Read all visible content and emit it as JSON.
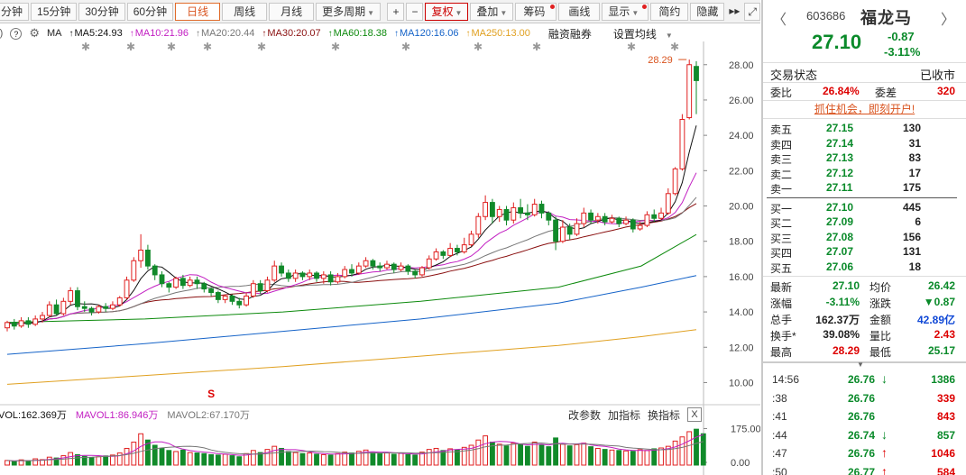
{
  "toolbar": {
    "periods": [
      "分钟",
      "15分钟",
      "30分钟",
      "60分钟",
      "日线",
      "周线",
      "月线",
      "更多周期"
    ],
    "active_period": "日线",
    "plus": "+",
    "minus": "−",
    "fuquan": "复权",
    "diejia": "叠加",
    "chouma": "筹码",
    "huaxian": "画线",
    "xianshi": "显示",
    "jianyue": "简约",
    "yincang": "隐藏",
    "more": "▸▸",
    "maximize": "⤢"
  },
  "ma_bar": {
    "lead": "()",
    "help": "?",
    "settings": "⚙",
    "items": [
      {
        "label": "MA",
        "color": "#222222",
        "arrow": ""
      },
      {
        "label": "MA5:24.93",
        "color": "#111111",
        "arrow": "↑"
      },
      {
        "label": "MA10:21.96",
        "color": "#c21fc2",
        "arrow": "↑"
      },
      {
        "label": "MA20:20.44",
        "color": "#777777",
        "arrow": "↑"
      },
      {
        "label": "MA30:20.07",
        "color": "#8a1010",
        "arrow": "↑"
      },
      {
        "label": "MA60:18.38",
        "color": "#0d8a0d",
        "arrow": "↑"
      },
      {
        "label": "MA120:16.06",
        "color": "#1563c8",
        "arrow": "↑"
      },
      {
        "label": "MA250:13.00",
        "color": "#e0a020",
        "arrow": "↑"
      }
    ],
    "rongzi": "融资融券",
    "settings_ma": "设置均线"
  },
  "chart_data": {
    "type": "candlestick",
    "y_ticks": [
      "28.00",
      "26.00",
      "24.00",
      "22.00",
      "20.00",
      "18.00",
      "16.00",
      "14.00",
      "12.00",
      "10.00"
    ],
    "ylim": [
      8.9,
      28.6
    ],
    "high_label": "28.29",
    "signal_label": "S",
    "candles": [
      {
        "o": 13.1,
        "c": 13.4,
        "h": 13.5,
        "l": 12.9
      },
      {
        "o": 13.4,
        "c": 13.2,
        "h": 13.6,
        "l": 13.0
      },
      {
        "o": 13.2,
        "c": 13.5,
        "h": 13.7,
        "l": 13.1
      },
      {
        "o": 13.5,
        "c": 13.3,
        "h": 13.7,
        "l": 13.1
      },
      {
        "o": 13.3,
        "c": 13.6,
        "h": 13.8,
        "l": 13.2
      },
      {
        "o": 13.6,
        "c": 13.8,
        "h": 14.0,
        "l": 13.4
      },
      {
        "o": 13.8,
        "c": 14.4,
        "h": 14.6,
        "l": 13.7
      },
      {
        "o": 14.4,
        "c": 13.9,
        "h": 14.7,
        "l": 13.8
      },
      {
        "o": 13.9,
        "c": 14.6,
        "h": 14.8,
        "l": 13.8
      },
      {
        "o": 14.6,
        "c": 15.2,
        "h": 15.4,
        "l": 14.4
      },
      {
        "o": 15.2,
        "c": 14.3,
        "h": 15.4,
        "l": 14.1
      },
      {
        "o": 14.3,
        "c": 14.2,
        "h": 14.6,
        "l": 14.0
      },
      {
        "o": 14.2,
        "c": 14.0,
        "h": 14.3,
        "l": 13.8
      },
      {
        "o": 14.0,
        "c": 14.3,
        "h": 14.4,
        "l": 13.9
      },
      {
        "o": 14.3,
        "c": 14.2,
        "h": 14.5,
        "l": 14.0
      },
      {
        "o": 14.2,
        "c": 14.4,
        "h": 14.6,
        "l": 14.1
      },
      {
        "o": 14.4,
        "c": 14.8,
        "h": 14.9,
        "l": 14.3
      },
      {
        "o": 14.8,
        "c": 15.8,
        "h": 16.0,
        "l": 14.7
      },
      {
        "o": 15.8,
        "c": 16.9,
        "h": 17.1,
        "l": 15.7
      },
      {
        "o": 16.9,
        "c": 17.5,
        "h": 18.4,
        "l": 16.5
      },
      {
        "o": 17.5,
        "c": 16.6,
        "h": 17.8,
        "l": 16.4
      },
      {
        "o": 16.6,
        "c": 16.1,
        "h": 16.7,
        "l": 15.8
      },
      {
        "o": 16.1,
        "c": 15.6,
        "h": 16.3,
        "l": 15.4
      },
      {
        "o": 15.6,
        "c": 15.4,
        "h": 15.7,
        "l": 15.1
      },
      {
        "o": 15.4,
        "c": 15.9,
        "h": 16.0,
        "l": 15.3
      },
      {
        "o": 15.9,
        "c": 15.5,
        "h": 16.1,
        "l": 15.3
      },
      {
        "o": 15.5,
        "c": 15.8,
        "h": 16.0,
        "l": 15.4
      },
      {
        "o": 15.8,
        "c": 15.6,
        "h": 16.0,
        "l": 15.3
      },
      {
        "o": 15.6,
        "c": 15.3,
        "h": 15.7,
        "l": 15.1
      },
      {
        "o": 15.3,
        "c": 15.1,
        "h": 15.4,
        "l": 14.9
      },
      {
        "o": 15.1,
        "c": 14.7,
        "h": 15.2,
        "l": 14.5
      },
      {
        "o": 14.7,
        "c": 14.9,
        "h": 15.0,
        "l": 14.5
      },
      {
        "o": 14.9,
        "c": 14.6,
        "h": 15.0,
        "l": 14.4
      },
      {
        "o": 14.6,
        "c": 14.4,
        "h": 14.8,
        "l": 14.2
      },
      {
        "o": 14.4,
        "c": 14.9,
        "h": 15.1,
        "l": 14.3
      },
      {
        "o": 14.9,
        "c": 15.6,
        "h": 15.8,
        "l": 14.8
      },
      {
        "o": 15.6,
        "c": 15.2,
        "h": 15.8,
        "l": 15.0
      },
      {
        "o": 15.2,
        "c": 15.8,
        "h": 16.0,
        "l": 15.1
      },
      {
        "o": 15.8,
        "c": 16.6,
        "h": 16.9,
        "l": 15.7
      },
      {
        "o": 16.6,
        "c": 16.2,
        "h": 16.8,
        "l": 16.0
      },
      {
        "o": 16.2,
        "c": 15.9,
        "h": 16.4,
        "l": 15.7
      },
      {
        "o": 15.9,
        "c": 16.2,
        "h": 16.4,
        "l": 15.7
      },
      {
        "o": 16.2,
        "c": 16.0,
        "h": 16.3,
        "l": 15.8
      },
      {
        "o": 16.0,
        "c": 16.2,
        "h": 16.4,
        "l": 15.8
      },
      {
        "o": 16.2,
        "c": 15.9,
        "h": 16.3,
        "l": 15.7
      },
      {
        "o": 15.9,
        "c": 16.1,
        "h": 16.3,
        "l": 15.6
      },
      {
        "o": 16.1,
        "c": 15.7,
        "h": 16.3,
        "l": 15.5
      },
      {
        "o": 15.7,
        "c": 16.0,
        "h": 16.2,
        "l": 15.6
      },
      {
        "o": 16.0,
        "c": 16.4,
        "h": 16.6,
        "l": 15.9
      },
      {
        "o": 16.4,
        "c": 16.2,
        "h": 16.7,
        "l": 16.0
      },
      {
        "o": 16.2,
        "c": 16.6,
        "h": 16.8,
        "l": 16.1
      },
      {
        "o": 16.6,
        "c": 16.9,
        "h": 17.1,
        "l": 16.5
      },
      {
        "o": 16.9,
        "c": 16.6,
        "h": 17.0,
        "l": 16.4
      },
      {
        "o": 16.6,
        "c": 16.5,
        "h": 16.8,
        "l": 16.3
      },
      {
        "o": 16.5,
        "c": 16.7,
        "h": 16.9,
        "l": 16.4
      },
      {
        "o": 16.7,
        "c": 16.4,
        "h": 16.8,
        "l": 16.2
      },
      {
        "o": 16.4,
        "c": 16.6,
        "h": 16.8,
        "l": 16.3
      },
      {
        "o": 16.6,
        "c": 16.3,
        "h": 16.7,
        "l": 16.1
      },
      {
        "o": 16.3,
        "c": 16.1,
        "h": 16.4,
        "l": 15.9
      },
      {
        "o": 16.1,
        "c": 16.5,
        "h": 16.6,
        "l": 16.0
      },
      {
        "o": 16.5,
        "c": 17.0,
        "h": 17.2,
        "l": 16.4
      },
      {
        "o": 17.0,
        "c": 17.4,
        "h": 17.6,
        "l": 16.9
      },
      {
        "o": 17.4,
        "c": 17.2,
        "h": 17.5,
        "l": 17.0
      },
      {
        "o": 17.2,
        "c": 17.6,
        "h": 17.9,
        "l": 17.1
      },
      {
        "o": 17.6,
        "c": 17.4,
        "h": 17.8,
        "l": 17.2
      },
      {
        "o": 17.4,
        "c": 17.8,
        "h": 18.2,
        "l": 17.3
      },
      {
        "o": 17.8,
        "c": 18.4,
        "h": 18.6,
        "l": 17.7
      },
      {
        "o": 18.4,
        "c": 19.4,
        "h": 19.6,
        "l": 18.2
      },
      {
        "o": 19.4,
        "c": 20.2,
        "h": 20.6,
        "l": 19.2
      },
      {
        "o": 20.2,
        "c": 19.4,
        "h": 20.4,
        "l": 19.0
      },
      {
        "o": 19.4,
        "c": 19.8,
        "h": 20.0,
        "l": 19.1
      },
      {
        "o": 19.8,
        "c": 19.2,
        "h": 20.0,
        "l": 18.9
      },
      {
        "o": 19.2,
        "c": 19.9,
        "h": 20.2,
        "l": 19.0
      },
      {
        "o": 19.9,
        "c": 19.6,
        "h": 20.4,
        "l": 19.3
      },
      {
        "o": 19.6,
        "c": 19.5,
        "h": 20.1,
        "l": 19.2
      },
      {
        "o": 19.5,
        "c": 20.1,
        "h": 20.4,
        "l": 19.4
      },
      {
        "o": 20.1,
        "c": 19.6,
        "h": 20.3,
        "l": 19.3
      },
      {
        "o": 19.6,
        "c": 19.2,
        "h": 19.7,
        "l": 18.9
      },
      {
        "o": 19.2,
        "c": 18.0,
        "h": 19.4,
        "l": 17.5
      },
      {
        "o": 18.0,
        "c": 18.8,
        "h": 19.2,
        "l": 17.9
      },
      {
        "o": 18.8,
        "c": 18.4,
        "h": 19.0,
        "l": 18.1
      },
      {
        "o": 18.4,
        "c": 19.0,
        "h": 19.3,
        "l": 18.3
      },
      {
        "o": 19.0,
        "c": 19.6,
        "h": 19.9,
        "l": 18.8
      },
      {
        "o": 19.6,
        "c": 19.2,
        "h": 19.8,
        "l": 19.0
      },
      {
        "o": 19.2,
        "c": 19.4,
        "h": 19.6,
        "l": 19.0
      },
      {
        "o": 19.4,
        "c": 19.1,
        "h": 19.6,
        "l": 18.9
      },
      {
        "o": 19.1,
        "c": 19.3,
        "h": 19.5,
        "l": 19.0
      },
      {
        "o": 19.3,
        "c": 19.0,
        "h": 19.4,
        "l": 18.8
      },
      {
        "o": 19.0,
        "c": 19.2,
        "h": 19.4,
        "l": 18.9
      },
      {
        "o": 19.2,
        "c": 18.7,
        "h": 19.3,
        "l": 18.5
      },
      {
        "o": 18.7,
        "c": 18.9,
        "h": 19.1,
        "l": 18.6
      },
      {
        "o": 18.9,
        "c": 19.5,
        "h": 19.7,
        "l": 18.8
      },
      {
        "o": 19.5,
        "c": 19.3,
        "h": 19.8,
        "l": 19.1
      },
      {
        "o": 19.3,
        "c": 19.6,
        "h": 19.9,
        "l": 19.2
      },
      {
        "o": 19.6,
        "c": 20.7,
        "h": 21.0,
        "l": 19.5
      },
      {
        "o": 20.7,
        "c": 22.1,
        "h": 22.2,
        "l": 20.6
      },
      {
        "o": 22.1,
        "c": 24.9,
        "h": 25.2,
        "l": 22.0
      },
      {
        "o": 25.0,
        "c": 28.0,
        "h": 28.29,
        "l": 24.9
      },
      {
        "o": 27.9,
        "c": 27.1,
        "h": 28.2,
        "l": 25.2
      }
    ],
    "volume_y_ticks": [
      "175.00",
      "0.00"
    ],
    "volume_ylim": [
      0,
      190
    ],
    "volumes": [
      22,
      18,
      25,
      20,
      30,
      26,
      38,
      34,
      45,
      60,
      50,
      42,
      35,
      40,
      44,
      48,
      58,
      80,
      110,
      150,
      120,
      95,
      80,
      70,
      65,
      72,
      60,
      58,
      55,
      50,
      48,
      52,
      45,
      40,
      55,
      70,
      60,
      75,
      90,
      80,
      65,
      60,
      55,
      58,
      52,
      50,
      48,
      55,
      62,
      58,
      66,
      72,
      60,
      55,
      58,
      52,
      56,
      50,
      48,
      62,
      75,
      80,
      70,
      78,
      72,
      85,
      95,
      120,
      140,
      110,
      100,
      92,
      105,
      98,
      90,
      110,
      95,
      88,
      130,
      100,
      92,
      98,
      105,
      88,
      80,
      75,
      72,
      70,
      68,
      66,
      74,
      70,
      78,
      82,
      90,
      115,
      135,
      160,
      172,
      150
    ],
    "vol_ma_labels": [
      "VOL:162.369万",
      "MAVOL1:86.946万",
      "MAVOL2:67.170万"
    ],
    "vol_ma_colors": [
      "#111111",
      "#c21fc2",
      "#777777"
    ],
    "ma_colors": {
      "ma5": "#111111",
      "ma10": "#c21fc2",
      "ma20": "#777777",
      "ma30": "#8a1010",
      "ma60": "#0d8a0d",
      "ma120": "#1563c8",
      "ma250": "#e0a020"
    },
    "ma60_path": [
      [
        0,
        13.4
      ],
      [
        20,
        13.6
      ],
      [
        40,
        14.0
      ],
      [
        60,
        14.6
      ],
      [
        80,
        15.4
      ],
      [
        92,
        16.6
      ],
      [
        100,
        18.38
      ]
    ],
    "ma120_path": [
      [
        0,
        11.6
      ],
      [
        20,
        12.2
      ],
      [
        40,
        12.9
      ],
      [
        60,
        13.6
      ],
      [
        80,
        14.5
      ],
      [
        92,
        15.4
      ],
      [
        100,
        16.06
      ]
    ],
    "ma250_path": [
      [
        0,
        9.9
      ],
      [
        20,
        10.4
      ],
      [
        40,
        10.9
      ],
      [
        60,
        11.5
      ],
      [
        80,
        12.1
      ],
      [
        92,
        12.6
      ],
      [
        100,
        13.0
      ]
    ],
    "vol_tools": [
      "改参数",
      "加指标",
      "换指标"
    ],
    "vol_close": "X"
  },
  "stock": {
    "code": "603686",
    "name": "福龙马",
    "price": "27.10",
    "change": "-0.87",
    "change_pct": "-3.11%",
    "nav_left": "〈",
    "nav_right": "〉"
  },
  "status": {
    "label": "交易状态",
    "value": "已收市"
  },
  "weibi": {
    "label1": "委比",
    "val1": "26.84%",
    "label2": "委差",
    "val2": "320"
  },
  "promo": "抓住机会，即刻开户!",
  "asks": [
    {
      "label": "卖五",
      "price": "27.15",
      "vol": "130"
    },
    {
      "label": "卖四",
      "price": "27.14",
      "vol": "31"
    },
    {
      "label": "卖三",
      "price": "27.13",
      "vol": "83"
    },
    {
      "label": "卖二",
      "price": "27.12",
      "vol": "17"
    },
    {
      "label": "卖一",
      "price": "27.11",
      "vol": "175"
    }
  ],
  "bids": [
    {
      "label": "买一",
      "price": "27.10",
      "vol": "445"
    },
    {
      "label": "买二",
      "price": "27.09",
      "vol": "6"
    },
    {
      "label": "买三",
      "price": "27.08",
      "vol": "156"
    },
    {
      "label": "买四",
      "price": "27.07",
      "vol": "131"
    },
    {
      "label": "买五",
      "price": "27.06",
      "vol": "18"
    }
  ],
  "stats": [
    {
      "l1": "最新",
      "v1": "27.10",
      "c1": "green",
      "l2": "均价",
      "v2": "26.42",
      "c2": "green"
    },
    {
      "l1": "涨幅",
      "v1": "-3.11%",
      "c1": "green",
      "l2": "涨跌",
      "v2": "▼0.87",
      "c2": "green"
    },
    {
      "l1": "总手",
      "v1": "162.37万",
      "c1": "dark",
      "l2": "金额",
      "v2": "42.89亿",
      "c2": "blue"
    },
    {
      "l1": "换手*",
      "v1": "39.08%",
      "c1": "dark",
      "l2": "量比",
      "v2": "2.43",
      "c2": "red"
    },
    {
      "l1": "最高",
      "v1": "28.29",
      "c1": "red",
      "l2": "最低",
      "v2": "25.17",
      "c2": "green"
    }
  ],
  "ticks": [
    {
      "time": "14:56",
      "price": "26.76",
      "arrow": "↓",
      "arrow_color": "green",
      "vol": "1386",
      "vol_color": "green"
    },
    {
      "time": ":38",
      "price": "26.76",
      "arrow": "",
      "arrow_color": "",
      "vol": "339",
      "vol_color": "red"
    },
    {
      "time": ":41",
      "price": "26.76",
      "arrow": "",
      "arrow_color": "",
      "vol": "843",
      "vol_color": "red"
    },
    {
      "time": ":44",
      "price": "26.74",
      "arrow": "↓",
      "arrow_color": "green",
      "vol": "857",
      "vol_color": "green"
    },
    {
      "time": ":47",
      "price": "26.76",
      "arrow": "↑",
      "arrow_color": "red",
      "vol": "1046",
      "vol_color": "red"
    },
    {
      "time": ":50",
      "price": "26.77",
      "arrow": "↑",
      "arrow_color": "red",
      "vol": "584",
      "vol_color": "red"
    }
  ]
}
